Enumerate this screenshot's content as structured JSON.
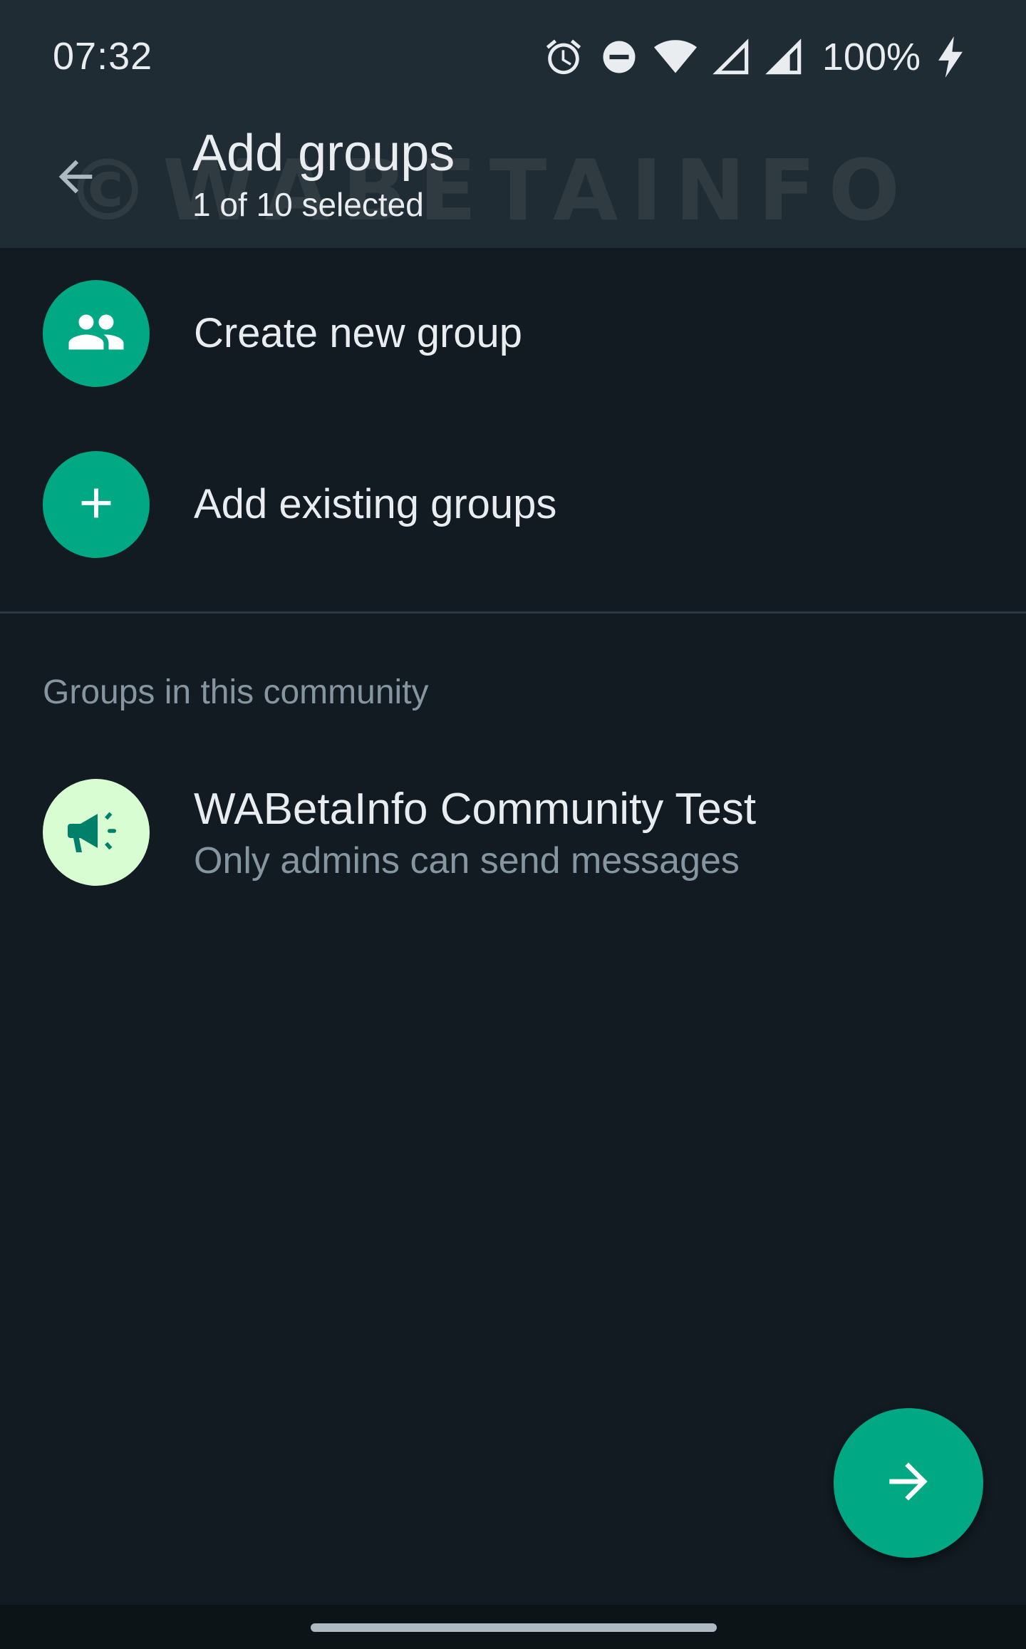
{
  "status_bar": {
    "time": "07:32",
    "battery": "100%",
    "icons": [
      "alarm-icon",
      "do-not-disturb-icon",
      "wifi-icon",
      "signal-icon",
      "signal-icon",
      "charging-icon"
    ]
  },
  "app_bar": {
    "title": "Add groups",
    "subtitle": "1 of 10 selected",
    "watermark": "©WABETAINFO",
    "back_icon": "arrow-back-icon"
  },
  "actions": [
    {
      "label": "Create new group",
      "icon": "group-icon"
    },
    {
      "label": "Add existing groups",
      "icon": "plus-icon"
    }
  ],
  "section": {
    "title": "Groups in this community"
  },
  "groups": [
    {
      "name": "WABetaInfo Community Test",
      "status": "Only admins can send messages",
      "icon": "megaphone-icon"
    }
  ],
  "fab": {
    "icon": "arrow-forward-icon"
  },
  "colors": {
    "background": "#121b22",
    "header": "#202c33",
    "accent": "#00a884",
    "announcement_avatar": "#d9fdd3",
    "primary_text": "#e9edef",
    "secondary_text": "#8696a0"
  }
}
